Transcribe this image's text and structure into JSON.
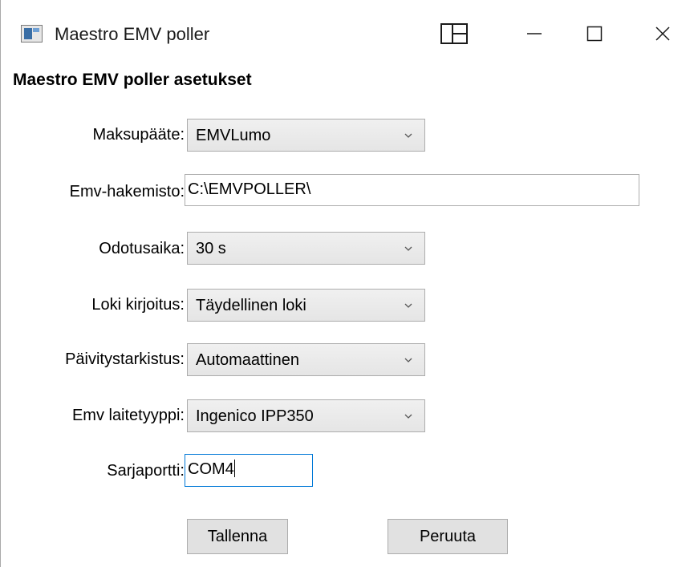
{
  "window": {
    "title": "Maestro EMV poller",
    "icons": {
      "app": "app-window-icon",
      "snap": "snap-layout-icon",
      "minimize": "minimize-icon",
      "maximize": "maximize-icon",
      "close": "close-icon"
    }
  },
  "form": {
    "heading": "Maestro EMV poller asetukset",
    "terminal": {
      "label": "Maksupääte:",
      "value": "EMVLumo"
    },
    "directory": {
      "label": "Emv-hakemisto:",
      "value": "C:\\EMVPOLLER\\"
    },
    "wait_time": {
      "label": "Odotusaika:",
      "value": "30 s"
    },
    "log_writing": {
      "label": "Loki kirjoitus:",
      "value": "Täydellinen loki"
    },
    "update_check": {
      "label": "Päivitystarkistus:",
      "value": "Automaattinen"
    },
    "device_type": {
      "label": "Emv laitetyyppi:",
      "value": "Ingenico IPP350"
    },
    "serial_port": {
      "label": "Sarjaportti:",
      "value": "COM4"
    }
  },
  "buttons": {
    "save": "Tallenna",
    "cancel": "Peruuta"
  },
  "colors": {
    "focus_border": "#0078d7",
    "control_border": "#acacac",
    "button_face": "#e1e1e1"
  }
}
